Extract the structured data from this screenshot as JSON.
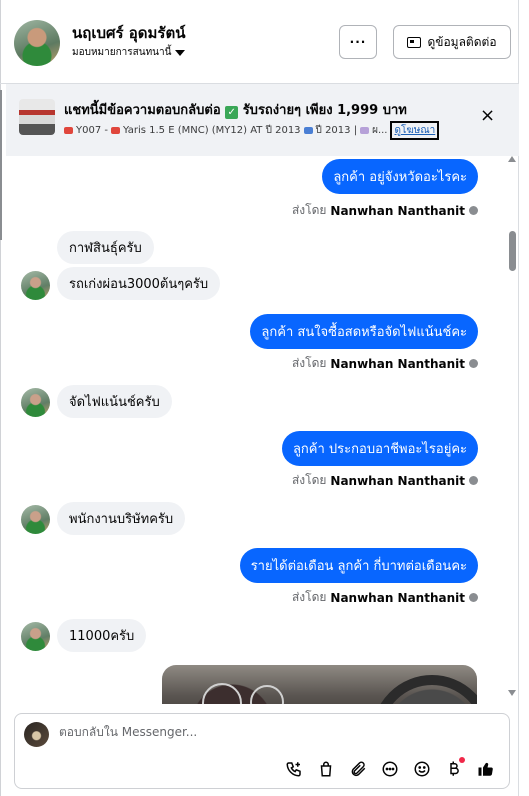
{
  "header": {
    "contact_name": "นฤเบศร์ อุดมรัตน์",
    "assignee_label": "มอบหมายการสนทนานี้",
    "more_label": "···",
    "contact_info_label": "ดูข้อมูลติดต่อ"
  },
  "banner": {
    "title": "แชทนี้มีข้อความตอบกลับต่อ ✅ รับรถง่ายๆ เพียง 1,999 บาท",
    "title_main": "แชทนี้มีข้อความตอบกลับต่อ",
    "title_rest": "รับรถง่ายๆ เพียง 1,999 บาท",
    "sub_code": "Y007 -",
    "sub_model": "Yaris 1.5 E (MNC) (MY12) AT ปี 2013",
    "sub_year": "ปี 2013 |",
    "sub_more": "ผ...",
    "ad_link": "ดูโฆษณา",
    "close_label": "×"
  },
  "messages": [
    {
      "dir": "out",
      "text": "ลูกค้า อยู่จังหวัดอะไรคะ"
    },
    {
      "dir": "meta",
      "prefix": "ส่งโดย",
      "sender": "Nanwhan Nanthanit"
    },
    {
      "dir": "in",
      "text": "กาฬสินธุ์ครับ"
    },
    {
      "dir": "in",
      "text": "รถเก่งผ่อน3000ต้นๆครับ"
    },
    {
      "dir": "out",
      "text": "ลูกค้า สนใจซื้อสดหรือจัดไฟแน้นช์คะ"
    },
    {
      "dir": "meta",
      "prefix": "ส่งโดย",
      "sender": "Nanwhan Nanthanit"
    },
    {
      "dir": "in",
      "text": "จัดไฟแน้นช์ครับ"
    },
    {
      "dir": "out",
      "text": "ลูกค้า ประกอบอาชีพอะไรอยู่คะ"
    },
    {
      "dir": "meta",
      "prefix": "ส่งโดย",
      "sender": "Nanwhan Nanthanit"
    },
    {
      "dir": "in",
      "text": "พนักงานบริษัทครับ"
    },
    {
      "dir": "out",
      "text": "รายได้ต่อเดือน ลูกค้า กี่บาทต่อเดือนคะ"
    },
    {
      "dir": "meta",
      "prefix": "ส่งโดย",
      "sender": "Nanwhan Nanthanit"
    },
    {
      "dir": "in",
      "text": "11000ครับ"
    }
  ],
  "composer": {
    "placeholder": "ตอบกลับใน Messenger..."
  },
  "icons": {
    "call": "phone-plus-icon",
    "shop": "shopping-bag-icon",
    "attach": "paperclip-icon",
    "saved_reply": "chat-bubble-icon",
    "emoji": "smiley-icon",
    "payment": "baht-icon",
    "like": "thumbs-up-icon"
  },
  "colors": {
    "outgoing_bubble": "#0866ff",
    "incoming_bubble": "#f0f2f5",
    "notification_dot": "#f02849"
  }
}
